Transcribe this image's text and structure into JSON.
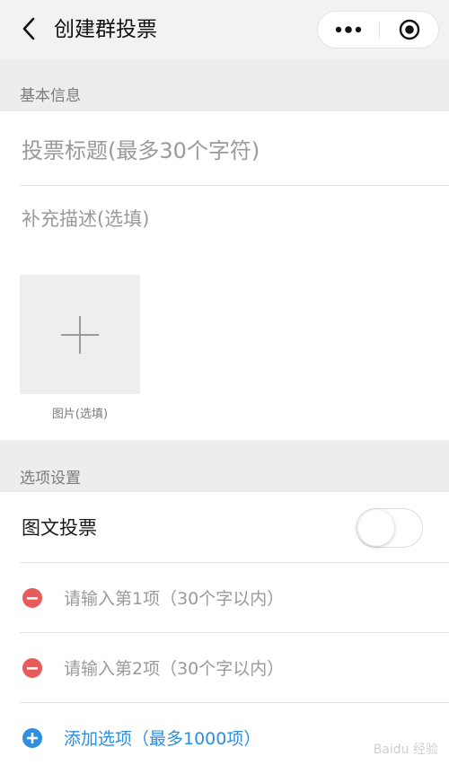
{
  "nav": {
    "title": "创建群投票",
    "back_icon": "chevron-left-icon",
    "more_icon": "more-dots-icon",
    "close_icon": "target-close-icon"
  },
  "basic_info": {
    "section_label": "基本信息",
    "title_placeholder": "投票标题(最多30个字符)",
    "desc_placeholder": "补充描述(选填)",
    "image_label": "图片(选填)"
  },
  "options": {
    "section_label": "选项设置",
    "image_vote_label": "图文投票",
    "image_vote_enabled": false,
    "items": [
      {
        "placeholder": "请输入第1项（30个字以内）"
      },
      {
        "placeholder": "请输入第2项（30个字以内）"
      }
    ],
    "add_label": "添加选项（最多1000项）"
  },
  "colors": {
    "remove": "#e85b5b",
    "add": "#2e8ee0"
  },
  "watermark": "Baidu 经验"
}
